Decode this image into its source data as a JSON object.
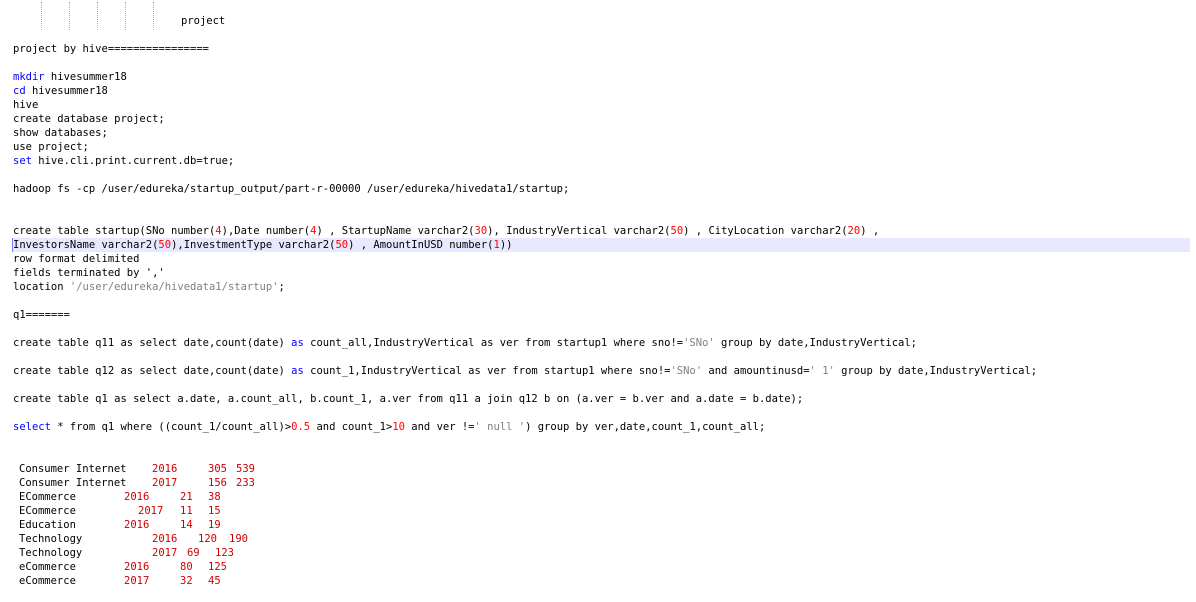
{
  "header": {
    "project_label": "project"
  },
  "title_line": "project by hive================",
  "commands": {
    "mkdir_kw": "mkdir",
    "mkdir_arg": " hivesummer18",
    "cd_kw": "cd",
    "cd_arg": " hivesummer18",
    "hive": "hive",
    "create_db": "create database project;",
    "show_db": "show databases;",
    "use_db": "use project;",
    "set_kw": "set",
    "set_arg": " hive.cli.print.current.db=true;"
  },
  "hadoop_line": "hadoop fs -cp /user/edureka/startup_output/part-r-00000 /user/edureka/hivedata1/startup;",
  "create_table": {
    "l1_a": "create table startup(SNo number(",
    "l1_n1": "4",
    "l1_b": "),Date number(",
    "l1_n2": "4",
    "l1_c": ") , StartupName varchar2(",
    "l1_n3": "30",
    "l1_d": "), IndustryVertical varchar2(",
    "l1_n4": "50",
    "l1_e": ") , CityLocation varchar2(",
    "l1_n5": "20",
    "l1_f": ") ,",
    "l2_a": "InvestorsName varchar2(",
    "l2_n1": "50",
    "l2_b": "),InvestmentType varchar2(",
    "l2_n2": "50",
    "l2_c": ") , AmountInUSD number(",
    "l2_n3": "1",
    "l2_d": "))",
    "l3": "row format delimited",
    "l4": "fields terminated by ','",
    "l5_a": "location ",
    "l5_str": "'/user/edureka/hivedata1/startup'",
    "l5_b": ";"
  },
  "q1_label": "q1=======",
  "queries": {
    "q11_a": "create table q11 as select date,count(date) ",
    "q11_as": "as",
    "q11_b": " count_all,IndustryVertical as ver from startup1 where sno!=",
    "q11_str": "'SNo'",
    "q11_c": " group by date,IndustryVertical;",
    "q12_a": "create table q12 as select date,count(date) ",
    "q12_as": "as",
    "q12_b": " count_1,IndustryVertical as ver from startup1 where sno!=",
    "q12_str": "'SNo'",
    "q12_c": " and amountinusd=",
    "q12_str2": "' 1'",
    "q12_d": " group by date,IndustryVertical;",
    "q1": "create table q1 as select a.date, a.count_all, b.count_1, a.ver from q11 a join q12 b on (a.ver = b.ver and a.date = b.date);",
    "sel_kw": "select",
    "sel_a": " * from q1 where ((count_1/count_all)>",
    "sel_n1": "0.5",
    "sel_b": " and count_1>",
    "sel_n2": "10",
    "sel_c": " and ver !=",
    "sel_str": "' null '",
    "sel_d": ") group by ver,date,count_1,count_all;"
  },
  "results": [
    {
      "name": "Consumer Internet",
      "year": "2016",
      "v1": "305",
      "v2": "539"
    },
    {
      "name": "Consumer Internet",
      "year": "2017",
      "v1": "156",
      "v2": "233"
    },
    {
      "name": "ECommerce",
      "year": "2016",
      "v1": "21",
      "v2": "38"
    },
    {
      "name": "ECommerce",
      "year": "2017",
      "v1": "11",
      "v2": "15"
    },
    {
      "name": "Education",
      "year": "2016",
      "v1": "14",
      "v2": "19"
    },
    {
      "name": "Technology",
      "year": "2016",
      "v1": "120",
      "v2": "190"
    },
    {
      "name": "Technology",
      "year": "2017",
      "v1": "69",
      "v2": "123"
    },
    {
      "name": "eCommerce",
      "year": "2016",
      "v1": "80",
      "v2": "125"
    },
    {
      "name": "eCommerce",
      "year": "2017",
      "v1": "32",
      "v2": "45"
    }
  ],
  "colors": {
    "keyword": "#0000ff",
    "number": "#ff0000",
    "string": "#808080",
    "current_line": "#e8e8ff"
  }
}
